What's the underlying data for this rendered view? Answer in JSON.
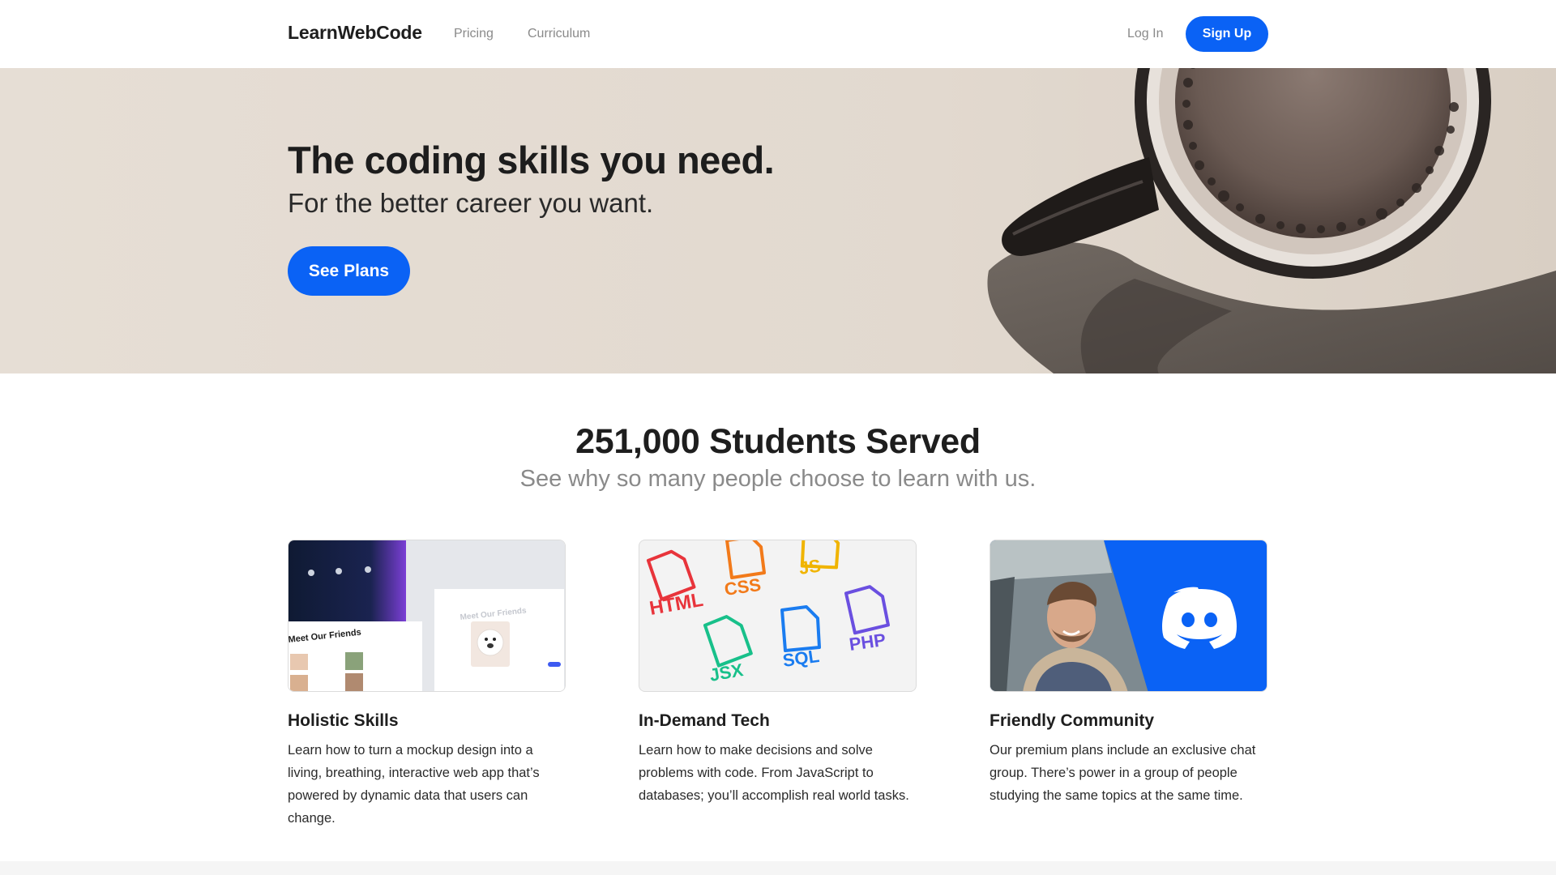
{
  "header": {
    "brand": "LearnWebCode",
    "nav": [
      {
        "label": "Pricing"
      },
      {
        "label": "Curriculum"
      }
    ],
    "login_label": "Log In",
    "signup_label": "Sign Up"
  },
  "hero": {
    "title": "The coding skills you need.",
    "subtitle": "For the better career you want.",
    "cta_label": "See Plans",
    "image": "coffee-mug-photo"
  },
  "stats": {
    "title": "251,000 Students Served",
    "subtitle": "See why so many people choose to learn with us."
  },
  "features": [
    {
      "title": "Holistic Skills",
      "text": "Learn how to turn a mockup design into a living, breathing, interactive web app that’s powered by dynamic data that users can change.",
      "image": "mockup-screenshot",
      "image_text": "Meet Our Friends"
    },
    {
      "title": "In-Demand Tech",
      "text": "Learn how to make decisions and solve problems with code. From JavaScript to databases; you’ll accomplish real world tasks.",
      "image": "tech-file-icons",
      "tech": [
        "HTML",
        "CSS",
        "JS",
        "JSX",
        "SQL",
        "PHP"
      ]
    },
    {
      "title": "Friendly Community",
      "text": "Our premium plans include an exclusive chat group. There’s power in a group of people studying the same topics at the same time.",
      "image": "community-photo-discord",
      "icon": "discord-logo-icon"
    }
  ],
  "colors": {
    "accent": "#0a62f5",
    "discord_blue": "#0a62f5",
    "muted_text": "#8a8a8a",
    "html": "#e8343b",
    "css": "#f27a1a",
    "js": "#f0b400",
    "jsx": "#18c08a",
    "sql": "#1a7cf0",
    "php": "#6a4fe0"
  }
}
